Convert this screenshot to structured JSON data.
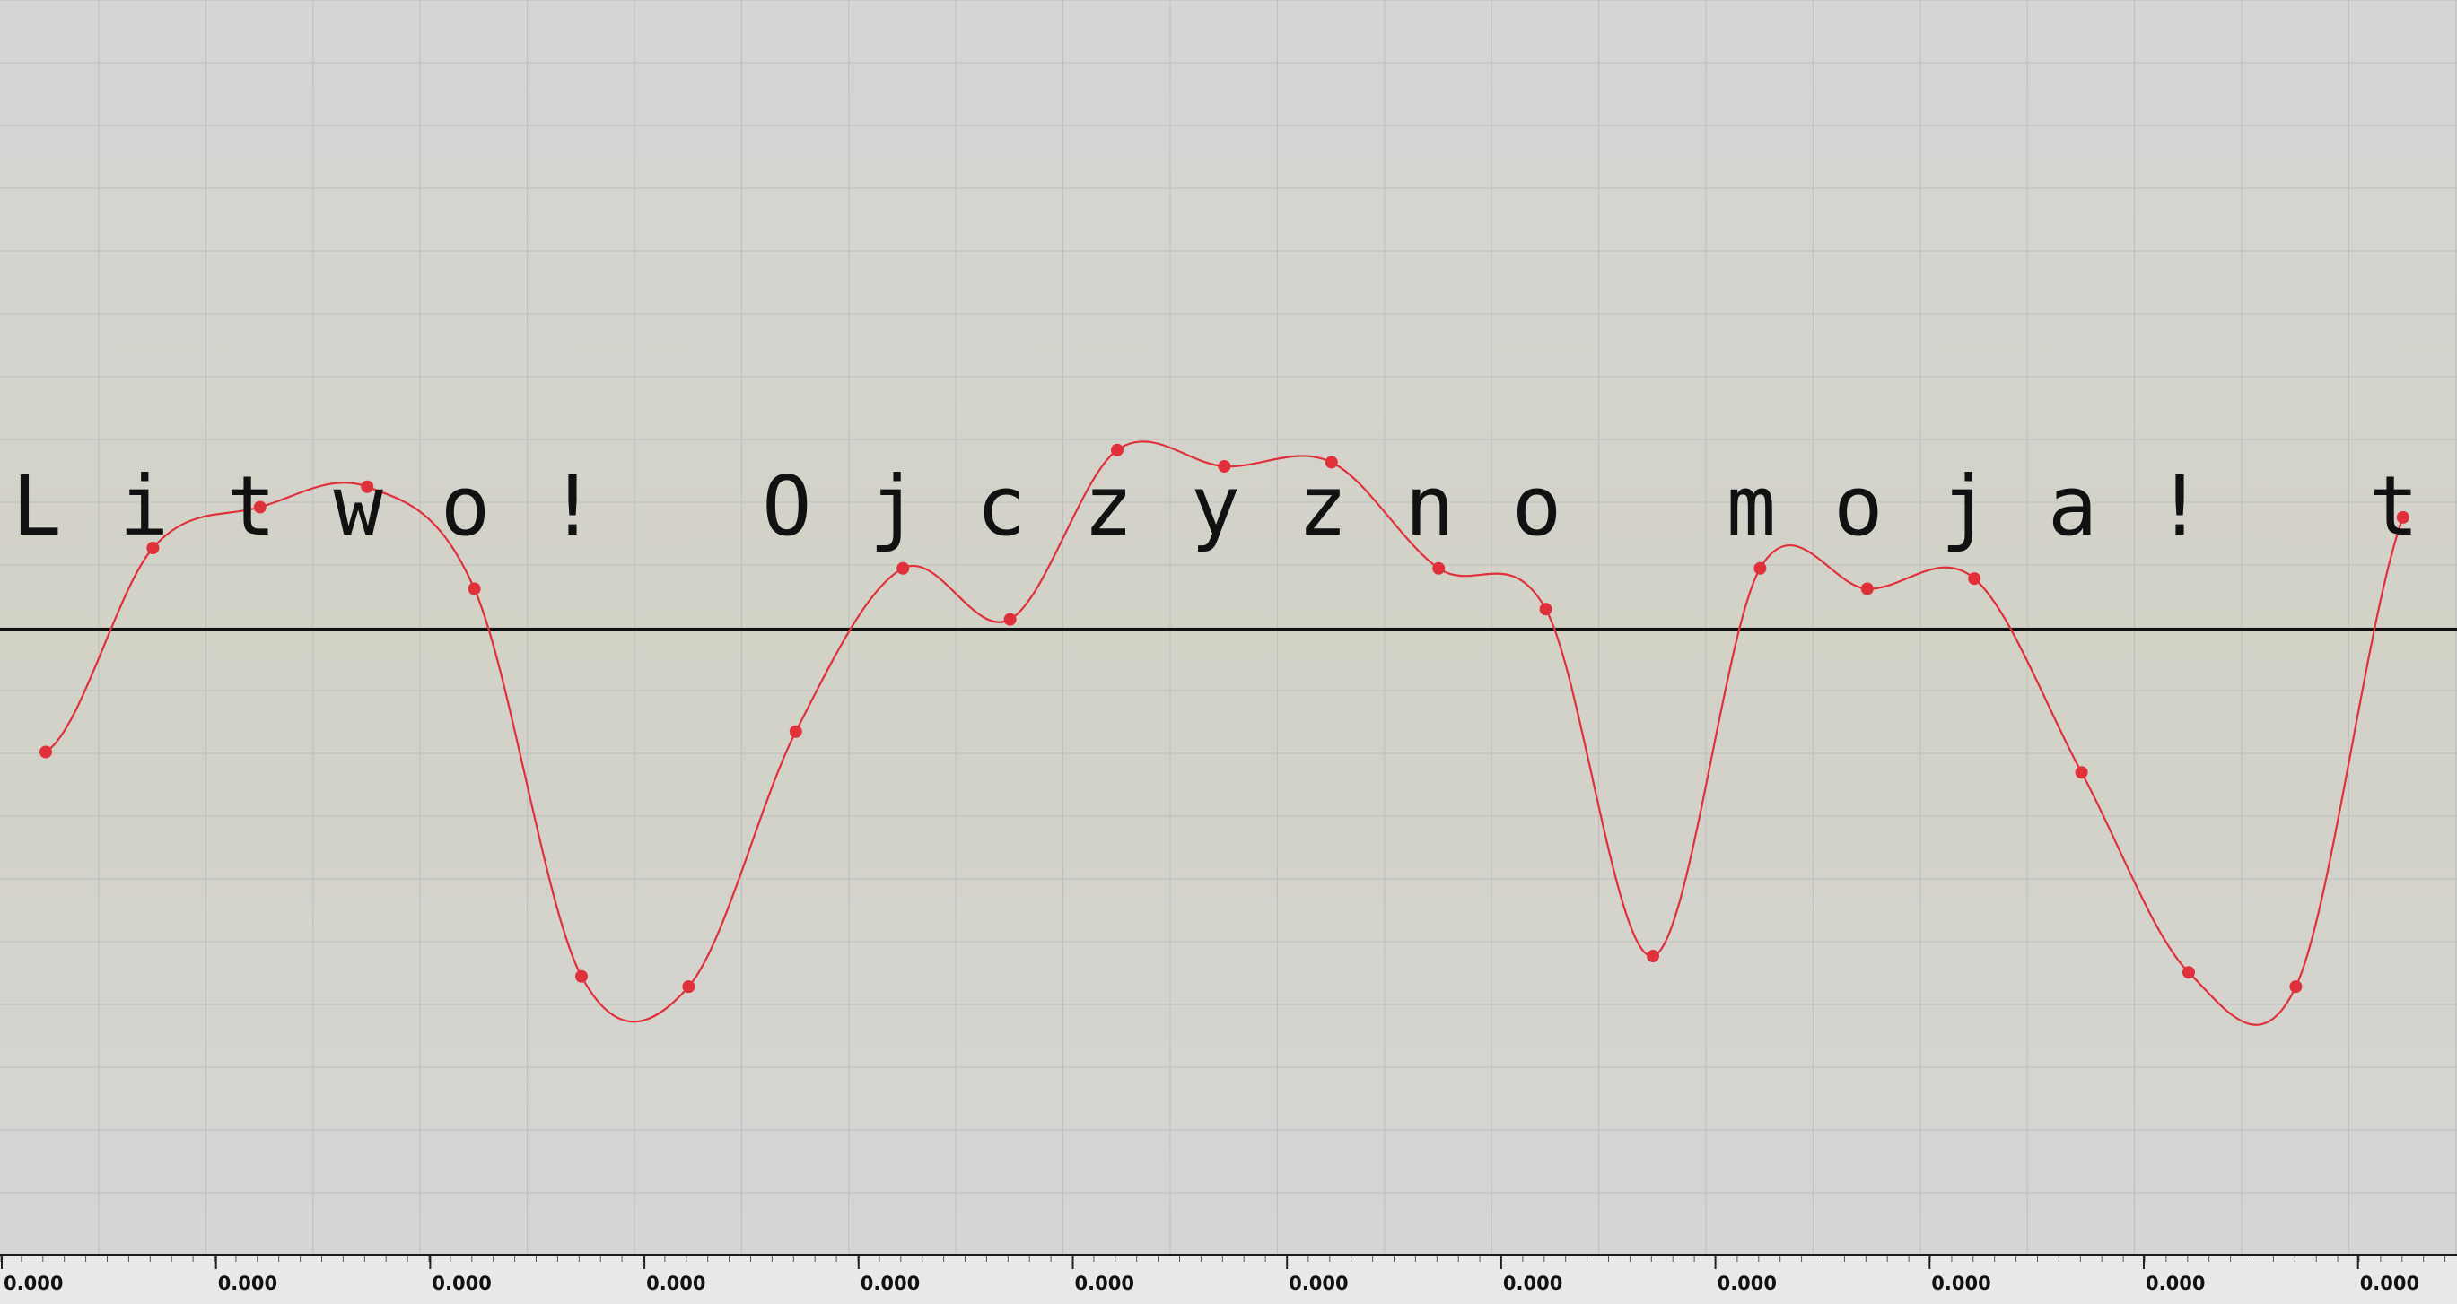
{
  "title_text": "Litwo! Ojczyzno moja! t",
  "glyphs": [
    "L",
    "i",
    "t",
    "w",
    "o",
    "!",
    "",
    "O",
    "j",
    "c",
    "z",
    "y",
    "z",
    "n",
    "o",
    "",
    "m",
    "o",
    "j",
    "a",
    "!",
    "",
    "t"
  ],
  "ruler": {
    "labels": [
      "0.000",
      "0.000",
      "0.000",
      "0.000",
      "0.000",
      "0.000",
      "0.000",
      "0.000",
      "0.000",
      "0.000",
      "0.000",
      "0.000"
    ]
  },
  "curve": {
    "color": "#e0303a",
    "baseline_color": "#111111",
    "keypoint_values": [
      -0.6,
      0.4,
      0.6,
      0.7,
      0.2,
      -1.7,
      -1.75,
      -0.5,
      0.3,
      0.05,
      0.88,
      0.8,
      0.82,
      0.3,
      0.1,
      -1.6,
      0.3,
      0.2,
      0.25,
      -0.7,
      -1.68,
      -1.75,
      0.55
    ]
  }
}
